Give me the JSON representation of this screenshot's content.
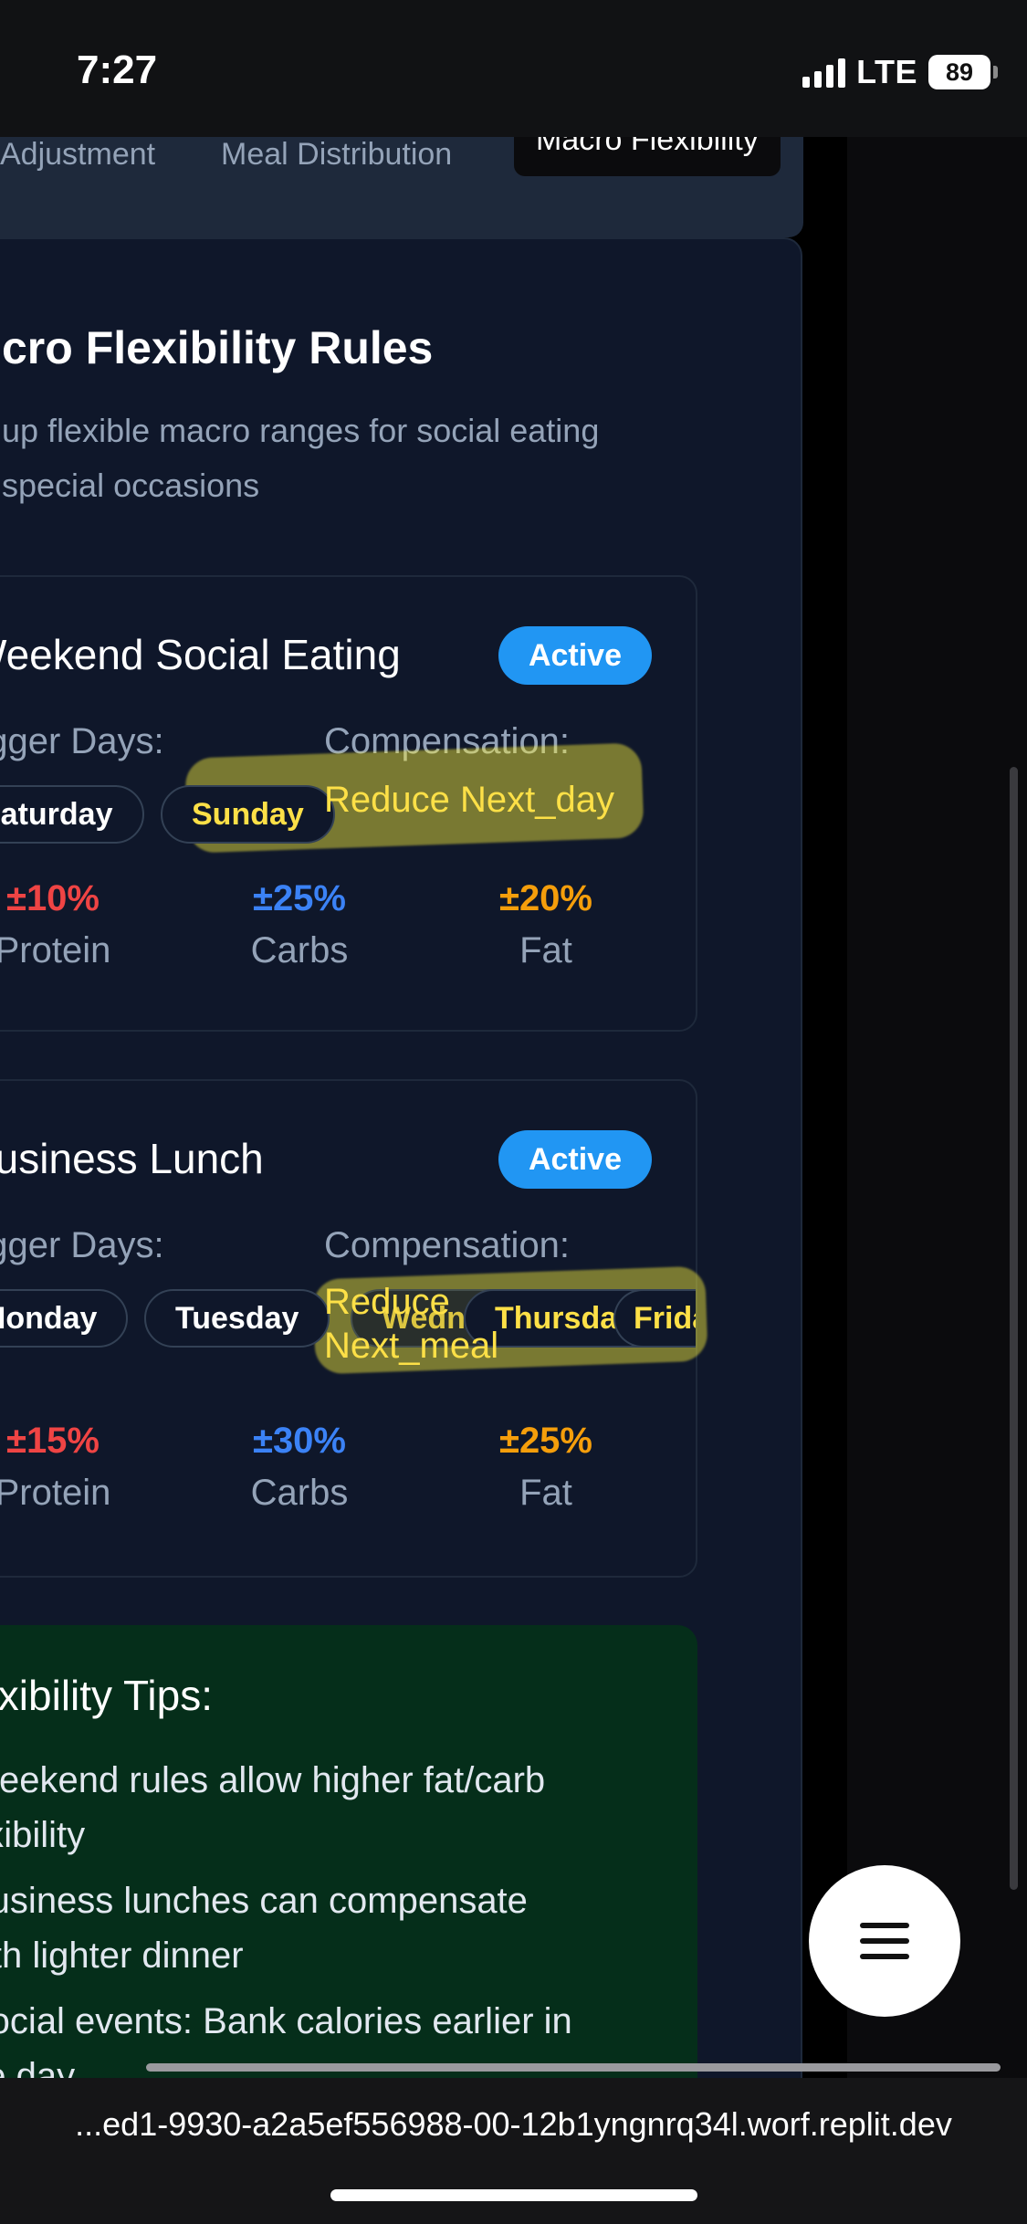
{
  "status_bar": {
    "time": "7:27",
    "network": "LTE",
    "battery": "89"
  },
  "tabs": [
    {
      "label": "Adjustment",
      "active": false
    },
    {
      "label": "Meal Distribution",
      "active": false
    },
    {
      "label": "Macro Flexibility",
      "active": true
    }
  ],
  "card": {
    "title": "cro Flexibility Rules",
    "description": "up flexible macro ranges for social eating\n special occasions"
  },
  "rules": [
    {
      "name": "Weekend Social Eating",
      "status": "Active",
      "trigger_label": "rigger Days:",
      "trigger_days": [
        "Saturday",
        "Sunday"
      ],
      "compensation_label": "Compensation:",
      "compensation": "Reduce Next_day",
      "macros": [
        {
          "value": "±10%",
          "name": "Protein"
        },
        {
          "value": "±25%",
          "name": "Carbs"
        },
        {
          "value": "±20%",
          "name": "Fat"
        }
      ]
    },
    {
      "name": "Business Lunch",
      "status": "Active",
      "trigger_label": "rigger Days:",
      "trigger_days": [
        "Monday",
        "Tuesday",
        "Wednesday",
        "Thursday",
        "Friday"
      ],
      "compensation_label": "Compensation:",
      "compensation_line1": "Reduce",
      "compensation_line2": "Next_meal",
      "macros": [
        {
          "value": "±15%",
          "name": "Protein"
        },
        {
          "value": "±30%",
          "name": "Carbs"
        },
        {
          "value": "±25%",
          "name": "Fat"
        }
      ]
    }
  ],
  "tips": {
    "title": "lexibility Tips:",
    "items": [
      "Weekend rules allow higher fat/carb\nexibility",
      "Business lunches can compensate\nvith lighter dinner",
      "Social events: Bank calories earlier in\nne day"
    ]
  },
  "url": "...ed1-9930-a2a5ef556988-00-12b1yngnrq34l.worf.replit.dev",
  "colors": {
    "accent": "#2196f3",
    "highlight": "#fde047",
    "protein": "#ef4444",
    "carbs": "#3b82f6",
    "fat": "#f59e0b",
    "tips_bg": "#052e1a"
  }
}
